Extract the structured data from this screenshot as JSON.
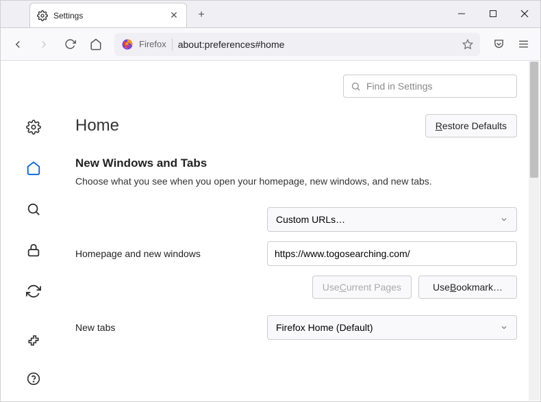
{
  "tab": {
    "title": "Settings"
  },
  "urlbar": {
    "identity": "Firefox",
    "address": "about:preferences#home"
  },
  "search": {
    "placeholder": "Find in Settings"
  },
  "page": {
    "title": "Home",
    "restore": "Restore Defaults",
    "section_title": "New Windows and Tabs",
    "section_desc": "Choose what you see when you open your homepage, new windows, and new tabs."
  },
  "homepage": {
    "select_label": "Custom URLs…",
    "field_label": "Homepage and new windows",
    "url_value": "https://www.togosearching.com/",
    "use_current": "Use Current Pages",
    "use_bookmark": "Use Bookmark…"
  },
  "newtabs": {
    "field_label": "New tabs",
    "select_label": "Firefox Home (Default)"
  }
}
